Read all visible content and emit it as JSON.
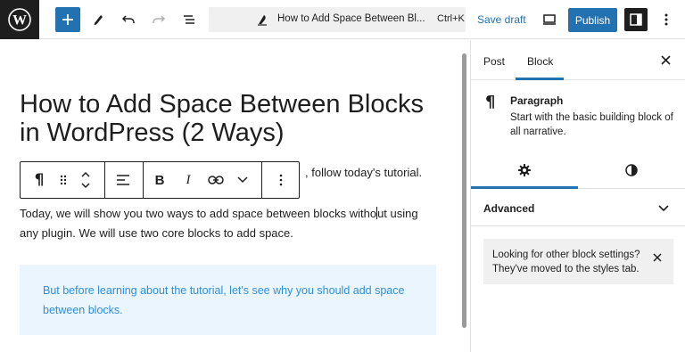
{
  "topbar": {
    "command_title": "How to Add Space Between Bl...",
    "shortcut": "Ctrl+K",
    "save_draft": "Save draft",
    "publish": "Publish"
  },
  "editor": {
    "title": "How to Add Space Between Blocks in WordPress (2 Ways)",
    "partial_line": ", follow today's tutorial.",
    "paragraph_before_caret": "Today, we will show you two ways to add space between blocks witho",
    "paragraph_after_caret": "ut using any plugin. We will use two core blocks to add space.",
    "callout": "But before learning about the tutorial, let's see why you should add space between blocks."
  },
  "sidebar": {
    "tabs": [
      {
        "label": "Post",
        "active": false
      },
      {
        "label": "Block",
        "active": true
      }
    ],
    "block_card": {
      "icon": "¶",
      "title": "Paragraph",
      "description": "Start with the basic building block of all narrative."
    },
    "sections": {
      "advanced": "Advanced"
    },
    "notice": "Looking for other block settings? They've moved to the styles tab."
  },
  "colors": {
    "accent": "#2271b1",
    "callout_bg": "#eaf5fe",
    "callout_text": "#2e8fd8"
  }
}
